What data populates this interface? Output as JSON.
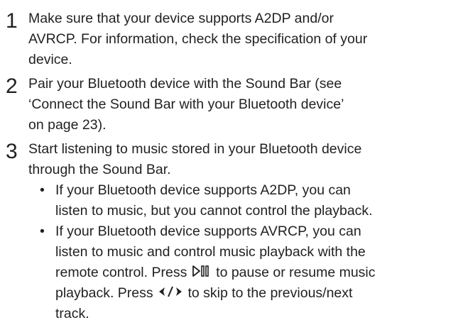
{
  "steps": [
    {
      "number": "1",
      "lines": [
        "Make sure that your device supports A2DP and/or",
        "AVRCP. For information, check the specification of your",
        "device."
      ]
    },
    {
      "number": "2",
      "lines": [
        "Pair your Bluetooth device with the Sound Bar (see",
        "‘Connect the Sound Bar with your Bluetooth device’",
        "on page 23)."
      ]
    },
    {
      "number": "3",
      "lines": [
        "Start listening to music stored in your Bluetooth device",
        "through the Sound Bar."
      ],
      "bullets": [
        {
          "marker": "•",
          "lines": [
            "If your Bluetooth device supports A2DP, you can",
            "listen to music, but you cannot control the playback."
          ]
        },
        {
          "marker": "•",
          "lines": [
            "If your Bluetooth device supports AVRCP, you can",
            "listen to music and control music playback with the"
          ],
          "line3_before": "remote control. Press ",
          "line3_after": " to pause or resume music",
          "line4_before": "playback. Press ",
          "line4_after": " to skip to the previous/next",
          "line5": "track.",
          "play_pause_icon": "play-pause-icon",
          "prev_next_icon": "previous-next-icon"
        }
      ]
    }
  ]
}
